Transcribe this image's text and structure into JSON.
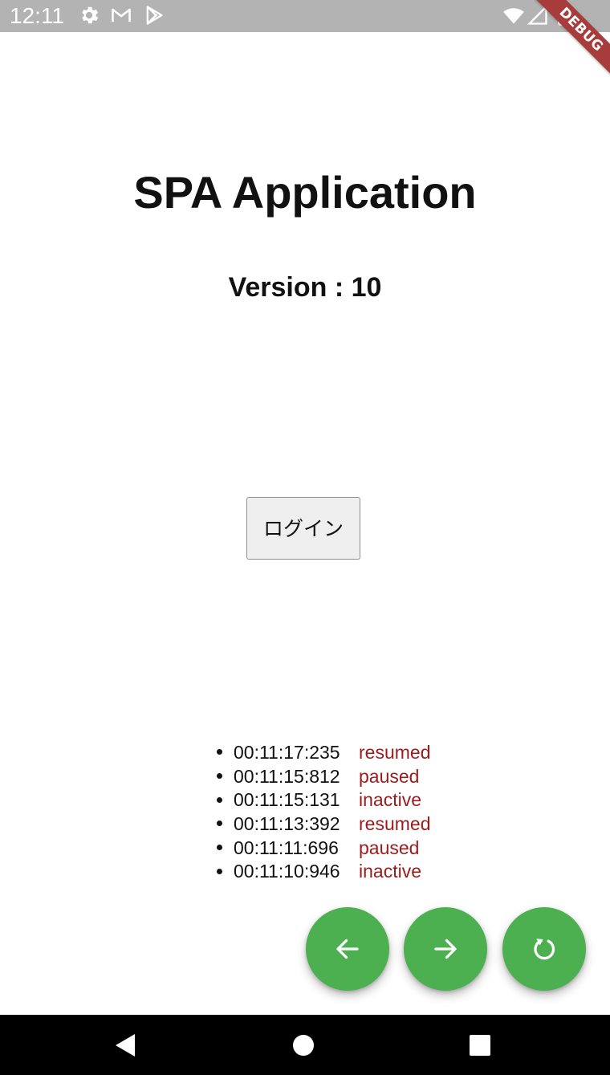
{
  "status_bar": {
    "time": "12:11",
    "icons": [
      "gear-icon",
      "gmail-icon",
      "play-store-icon",
      "wifi-icon",
      "cell-signal-icon",
      "battery-icon"
    ]
  },
  "debug_banner": {
    "label": "DEBUG"
  },
  "main": {
    "title": "SPA Application",
    "version_label": "Version : 10",
    "login_button_label": "ログイン"
  },
  "lifecycle_log": [
    {
      "time": "00:11:17:235",
      "state": "resumed"
    },
    {
      "time": "00:11:15:812",
      "state": "paused"
    },
    {
      "time": "00:11:15:131",
      "state": "inactive"
    },
    {
      "time": "00:11:13:392",
      "state": "resumed"
    },
    {
      "time": "00:11:11:696",
      "state": "paused"
    },
    {
      "time": "00:11:10:946",
      "state": "inactive"
    }
  ],
  "fabs": [
    {
      "icon": "arrow-back-icon"
    },
    {
      "icon": "arrow-forward-icon"
    },
    {
      "icon": "refresh-icon"
    }
  ],
  "colors": {
    "status_bar": "#b3b3b3",
    "fab": "#4caf50",
    "log_state": "#9b1c1c",
    "debug_banner": "#a83b3b"
  },
  "nav_bar": {
    "icons": [
      "back-triangle-icon",
      "home-circle-icon",
      "recents-square-icon"
    ]
  }
}
